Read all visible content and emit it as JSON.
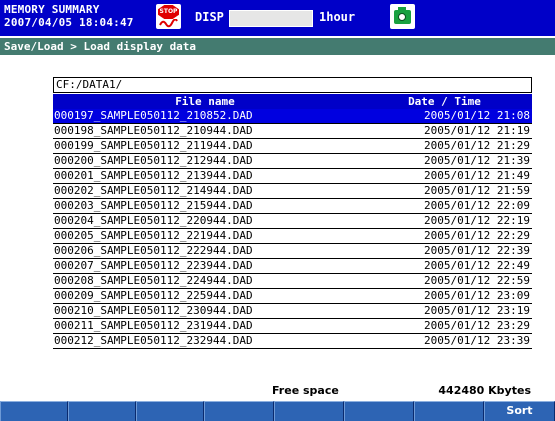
{
  "header": {
    "mode_label": "MEMORY SUMMARY",
    "datetime": "2007/04/05 18:04:47",
    "stop_icon_text": "STOP",
    "disp_label": "DISP",
    "time_span": "1hour"
  },
  "breadcrumb": "Save/Load > Load display data",
  "path": "CF:/DATA1/",
  "table": {
    "col_filename": "File name",
    "col_datetime": "Date / Time",
    "selected_index": 0,
    "rows": [
      {
        "name": "000197_SAMPLE050112_210852.DAD",
        "date": "2005/01/12 21:08"
      },
      {
        "name": "000198_SAMPLE050112_210944.DAD",
        "date": "2005/01/12 21:19"
      },
      {
        "name": "000199_SAMPLE050112_211944.DAD",
        "date": "2005/01/12 21:29"
      },
      {
        "name": "000200_SAMPLE050112_212944.DAD",
        "date": "2005/01/12 21:39"
      },
      {
        "name": "000201_SAMPLE050112_213944.DAD",
        "date": "2005/01/12 21:49"
      },
      {
        "name": "000202_SAMPLE050112_214944.DAD",
        "date": "2005/01/12 21:59"
      },
      {
        "name": "000203_SAMPLE050112_215944.DAD",
        "date": "2005/01/12 22:09"
      },
      {
        "name": "000204_SAMPLE050112_220944.DAD",
        "date": "2005/01/12 22:19"
      },
      {
        "name": "000205_SAMPLE050112_221944.DAD",
        "date": "2005/01/12 22:29"
      },
      {
        "name": "000206_SAMPLE050112_222944.DAD",
        "date": "2005/01/12 22:39"
      },
      {
        "name": "000207_SAMPLE050112_223944.DAD",
        "date": "2005/01/12 22:49"
      },
      {
        "name": "000208_SAMPLE050112_224944.DAD",
        "date": "2005/01/12 22:59"
      },
      {
        "name": "000209_SAMPLE050112_225944.DAD",
        "date": "2005/01/12 23:09"
      },
      {
        "name": "000210_SAMPLE050112_230944.DAD",
        "date": "2005/01/12 23:19"
      },
      {
        "name": "000211_SAMPLE050112_231944.DAD",
        "date": "2005/01/12 23:29"
      },
      {
        "name": "000212_SAMPLE050112_232944.DAD",
        "date": "2005/01/12 23:39"
      }
    ]
  },
  "footer": {
    "free_space_label": "Free space",
    "free_space_value": "442480 Kbytes"
  },
  "softkeys": [
    "",
    "",
    "",
    "",
    "",
    "",
    "",
    "Sort"
  ],
  "colors": {
    "header_bg": "#0000c8",
    "breadcrumb_bg": "#447b70",
    "selection_bg": "#0000e0",
    "softkey_bg": "#2d64b4"
  }
}
